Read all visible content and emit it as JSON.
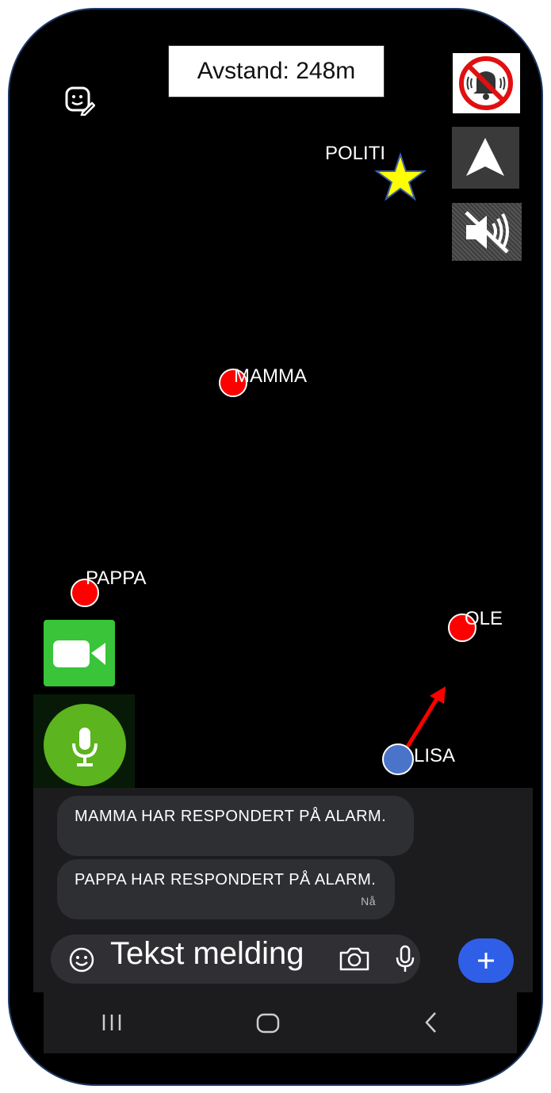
{
  "distance_label": "Avstand: 248m",
  "icons": {
    "sticker": "emoji-sticker-icon",
    "alarm_off": "alarm-off-icon",
    "navigate": "navigation-arrow-icon",
    "mute": "speaker-muted-icon",
    "video": "video-call-icon",
    "mic": "microphone-icon",
    "emoji": "emoji-icon",
    "camera": "camera-icon",
    "voice": "voice-icon",
    "add": "plus-icon",
    "recents": "recents-icon",
    "home": "home-icon",
    "back": "back-icon"
  },
  "map": {
    "police_label": "POLITI",
    "people": [
      {
        "name": "MAMMA",
        "color": "#ff0000"
      },
      {
        "name": "PAPPA",
        "color": "#ff0000"
      },
      {
        "name": "OLE",
        "color": "#ff0000"
      },
      {
        "name": "LISA",
        "color": "#4a74c9"
      }
    ],
    "direction_color": "#ff0000"
  },
  "chat": {
    "messages": [
      {
        "text": "MAMMA HAR RESPONDERT PÅ ALARM.",
        "time": ""
      },
      {
        "text": "PAPPA HAR RESPONDERT PÅ ALARM.",
        "time": "Nå"
      }
    ],
    "input_placeholder": "Tekst melding"
  },
  "colors": {
    "accent_blue": "#2f5fe6",
    "mic_green": "#5cb41e",
    "facetime_green": "#39c43a",
    "police_star": "#ffff00"
  }
}
